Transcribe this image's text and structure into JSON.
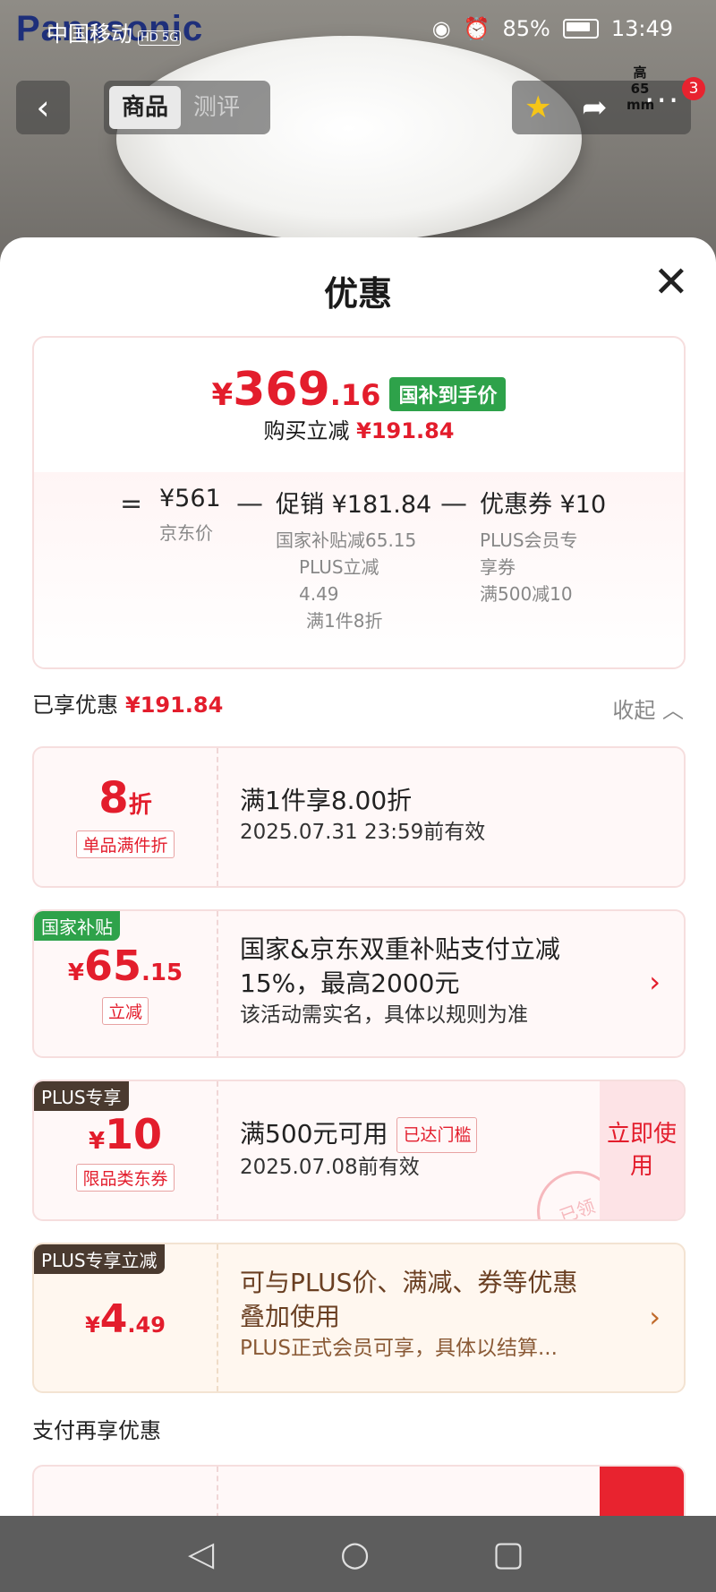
{
  "status_bar": {
    "carrier": "中国移动",
    "network": "HD 5G",
    "battery": "85%",
    "time": "13:49"
  },
  "background_brand": "Panasonic",
  "nav": {
    "back": "‹",
    "tabs": [
      {
        "label": "商品"
      },
      {
        "label": "测评"
      }
    ],
    "cart_count": "3",
    "more": "···"
  },
  "dimension_label": "高 65 mm",
  "sheet": {
    "title": "优惠",
    "close": "✕",
    "summary": {
      "yen": "¥",
      "price_int": "369",
      "price_dec": ".16",
      "price_tag": "国补到手价",
      "reduce_label": "购买立减",
      "reduce_amount": "¥191.84",
      "eq": "=",
      "minus": "—",
      "jd_price": "¥561",
      "jd_price_label": "京东价",
      "promo_head": "促销 ¥181.84",
      "promo_sub1": "国家补贴减65.15",
      "promo_sub2": "PLUS立减",
      "promo_sub3": "4.49",
      "promo_sub4": "满1件8折",
      "coupon_head": "优惠券 ¥10",
      "coupon_sub1": "PLUS会员专",
      "coupon_sub2": "享券",
      "coupon_sub3": "满500减10"
    },
    "enjoyed_label": "已享优惠",
    "enjoyed_amount": "¥191.84",
    "collapse": "收起 ︿",
    "cards": [
      {
        "value": "8",
        "unit": "折",
        "tag": "单品满件折",
        "line1": "满1件享8.00折",
        "line2": "2025.07.31 23:59前有效"
      },
      {
        "corner": "国家补贴",
        "yen": "¥",
        "value": "65",
        "dec": ".15",
        "tag": "立减",
        "line1": "国家&京东双重补贴支付立减",
        "line1b": "15%，最高2000元",
        "line2": "该活动需实名，具体以规则为准",
        "chev": "›"
      },
      {
        "corner": "PLUS专享",
        "yen": "¥",
        "value": "10",
        "tag": "限品类东券",
        "line1": "满500元可用",
        "pill": "已达门槛",
        "line2": "2025.07.08前有效",
        "button": "立即使用",
        "stamp": "已领"
      },
      {
        "corner": "PLUS专享立减",
        "yen": "¥",
        "value": "4",
        "dec": ".49",
        "line1": "可与PLUS价、满减、券等优惠",
        "line1b": "叠加使用",
        "line2": "PLUS正式会员可享，具体以结算...",
        "chev": "›"
      }
    ],
    "pay_section_label": "支付再享优惠"
  },
  "android_nav": {
    "back": "◁",
    "home": "○",
    "recent": "▢"
  }
}
